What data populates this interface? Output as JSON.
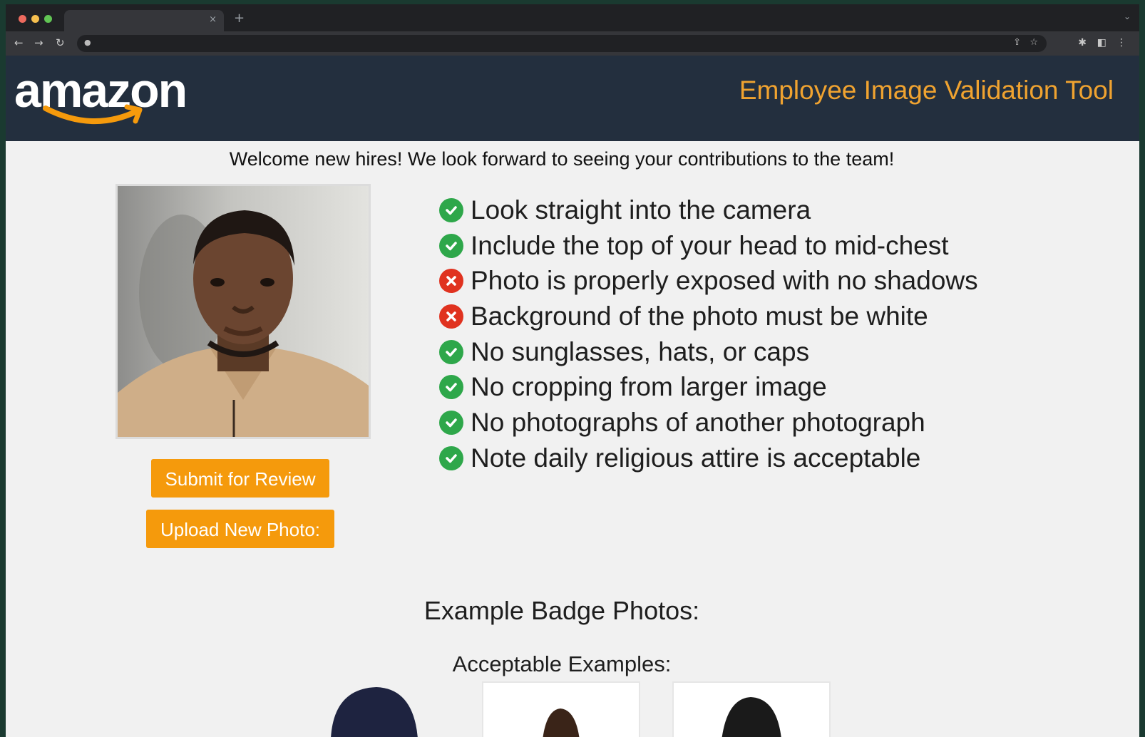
{
  "browser": {
    "tab_close": "×",
    "new_tab": "+",
    "tab_menu": "⌄"
  },
  "header": {
    "logo_text": "amazon",
    "title": "Employee Image Validation Tool"
  },
  "main": {
    "welcome": "Welcome new hires! We look forward to seeing your contributions to the team!",
    "buttons": {
      "submit": "Submit for Review",
      "upload": "Upload New Photo:"
    },
    "checklist": [
      {
        "status": "pass",
        "text": "Look straight into the camera"
      },
      {
        "status": "pass",
        "text": "Include the top of your head to mid-chest"
      },
      {
        "status": "fail",
        "text": "Photo is properly exposed with no shadows"
      },
      {
        "status": "fail",
        "text": "Background of the photo must be white"
      },
      {
        "status": "pass",
        "text": "No sunglasses, hats, or caps"
      },
      {
        "status": "pass",
        "text": "No cropping from larger image"
      },
      {
        "status": "pass",
        "text": "No photographs of another photograph"
      },
      {
        "status": "pass",
        "text": "Note daily religious attire is acceptable"
      }
    ],
    "examples": {
      "title": "Example Badge Photos:",
      "subtitle": "Acceptable Examples:"
    }
  },
  "colors": {
    "header_bg": "#232f3e",
    "accent_orange": "#f59a0c",
    "title_orange": "#f0a330",
    "pass_green": "#2ea74a",
    "fail_red": "#e0321f"
  }
}
